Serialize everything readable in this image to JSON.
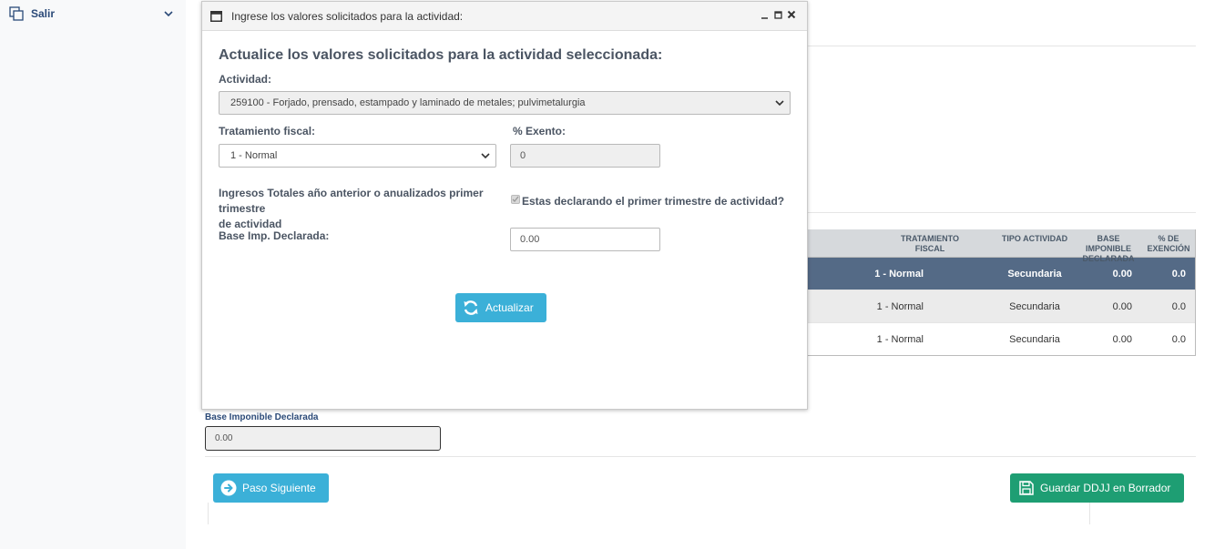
{
  "sidebar": {
    "items": [
      {
        "label": "Salir",
        "icon": "copy-icon"
      }
    ]
  },
  "modal": {
    "title": "Ingrese los valores solicitados para la actividad:",
    "heading": "Actualice los valores solicitados para la actividad seleccionada:",
    "actividad_label": "Actividad:",
    "actividad_value": "259100 - Forjado, prensado, estampado y laminado de metales; pulvimetalurgia",
    "tratamiento_label": "Tratamiento fiscal:",
    "tratamiento_value": "1 - Normal",
    "exento_label": "% Exento:",
    "exento_value": "0",
    "ingresos_label_line1": "Ingresos Totales año anterior o anualizados primer trimestre",
    "ingresos_label_line2": "de actividad",
    "primer_trimestre_label": "Estas declarando el primer trimestre de actividad?",
    "base_label": "Base Imp. Declarada:",
    "base_value": "0.00",
    "update_button": "Actualizar"
  },
  "table": {
    "headers": [
      "TRATAMIENTO FISCAL",
      "TIPO ACTIVIDAD",
      "BASE IMPONIBLE DECLARADA",
      "% DE EXENCIÓN"
    ],
    "rows": [
      {
        "tratamiento": "1 - Normal",
        "tipo": "Secundaria",
        "base": "0.00",
        "exencion": "0.0"
      },
      {
        "tratamiento": "1 - Normal",
        "tipo": "Secundaria",
        "base": "0.00",
        "exencion": "0.0"
      },
      {
        "tratamiento": "1 - Normal",
        "tipo": "Secundaria",
        "base": "0.00",
        "exencion": "0.0"
      }
    ]
  },
  "base_imponible": {
    "label": "Base Imponible Declarada",
    "value": "0.00"
  },
  "buttons": {
    "next": "Paso Siguiente",
    "save": "Guardar DDJJ en Borrador"
  },
  "colors": {
    "accent": "#3bb0d8",
    "save": "#1e9e73",
    "selected_row": "#546a86"
  }
}
